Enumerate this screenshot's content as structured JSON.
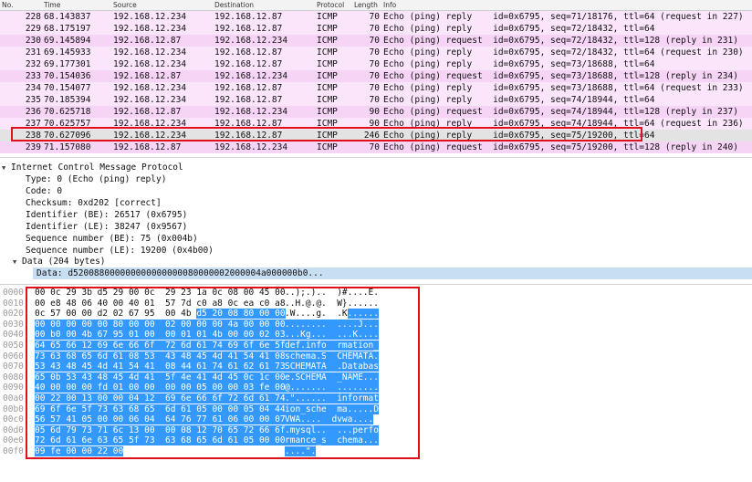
{
  "packet_list": {
    "columns": {
      "no": "No.",
      "time": "Time",
      "source": "Source",
      "destination": "Destination",
      "protocol": "Protocol",
      "length": "Length",
      "info": "Info"
    },
    "rows": [
      {
        "no": "228",
        "time": "68.143837",
        "src": "192.168.12.234",
        "dst": "192.168.12.87",
        "proto": "ICMP",
        "len": "70",
        "info": "Echo (ping) reply    id=0x6795, seq=71/18176, ttl=64 (request in 227)",
        "kind": "reply"
      },
      {
        "no": "229",
        "time": "68.175197",
        "src": "192.168.12.234",
        "dst": "192.168.12.87",
        "proto": "ICMP",
        "len": "70",
        "info": "Echo (ping) reply    id=0x6795, seq=72/18432, ttl=64",
        "kind": "reply"
      },
      {
        "no": "230",
        "time": "69.145894",
        "src": "192.168.12.87",
        "dst": "192.168.12.234",
        "proto": "ICMP",
        "len": "70",
        "info": "Echo (ping) request  id=0x6795, seq=72/18432, ttl=128 (reply in 231)",
        "kind": "request"
      },
      {
        "no": "231",
        "time": "69.145933",
        "src": "192.168.12.234",
        "dst": "192.168.12.87",
        "proto": "ICMP",
        "len": "70",
        "info": "Echo (ping) reply    id=0x6795, seq=72/18432, ttl=64 (request in 230)",
        "kind": "reply"
      },
      {
        "no": "232",
        "time": "69.177301",
        "src": "192.168.12.234",
        "dst": "192.168.12.87",
        "proto": "ICMP",
        "len": "70",
        "info": "Echo (ping) reply    id=0x6795, seq=73/18688, ttl=64",
        "kind": "reply"
      },
      {
        "no": "233",
        "time": "70.154036",
        "src": "192.168.12.87",
        "dst": "192.168.12.234",
        "proto": "ICMP",
        "len": "70",
        "info": "Echo (ping) request  id=0x6795, seq=73/18688, ttl=128 (reply in 234)",
        "kind": "request"
      },
      {
        "no": "234",
        "time": "70.154077",
        "src": "192.168.12.234",
        "dst": "192.168.12.87",
        "proto": "ICMP",
        "len": "70",
        "info": "Echo (ping) reply    id=0x6795, seq=73/18688, ttl=64 (request in 233)",
        "kind": "reply"
      },
      {
        "no": "235",
        "time": "70.185394",
        "src": "192.168.12.234",
        "dst": "192.168.12.87",
        "proto": "ICMP",
        "len": "70",
        "info": "Echo (ping) reply    id=0x6795, seq=74/18944, ttl=64",
        "kind": "reply"
      },
      {
        "no": "236",
        "time": "70.625718",
        "src": "192.168.12.87",
        "dst": "192.168.12.234",
        "proto": "ICMP",
        "len": "90",
        "info": "Echo (ping) request  id=0x6795, seq=74/18944, ttl=128 (reply in 237)",
        "kind": "request"
      },
      {
        "no": "237",
        "time": "70.625757",
        "src": "192.168.12.234",
        "dst": "192.168.12.87",
        "proto": "ICMP",
        "len": "90",
        "info": "Echo (ping) reply    id=0x6795, seq=74/18944, ttl=64 (request in 236)",
        "kind": "reply"
      },
      {
        "no": "238",
        "time": "70.627096",
        "src": "192.168.12.234",
        "dst": "192.168.12.87",
        "proto": "ICMP",
        "len": "246",
        "info": "Echo (ping) reply    id=0x6795, seq=75/19200, ttl=64",
        "kind": "selected"
      },
      {
        "no": "239",
        "time": "71.157080",
        "src": "192.168.12.87",
        "dst": "192.168.12.234",
        "proto": "ICMP",
        "len": "70",
        "info": "Echo (ping) request  id=0x6795, seq=75/19200, ttl=128 (reply in 240)",
        "kind": "request"
      }
    ]
  },
  "details": {
    "section_title": "Internet Control Message Protocol",
    "fields": [
      "Type: 0 (Echo (ping) reply)",
      "Code: 0",
      "Checksum: 0xd202 [correct]",
      "Identifier (BE): 26517 (0x6795)",
      "Identifier (LE): 38247 (0x9567)",
      "Sequence number (BE): 75 (0x004b)",
      "Sequence number (LE): 19200 (0x4b00)"
    ],
    "data_title": "Data (204 bytes)",
    "data_value": "Data: d520088000000000000000080000002000004a000000b0..."
  },
  "hex_dump": [
    {
      "offset": "0000",
      "pre": "00 0c 29 3b d5 29 00 0c  29 23 1a 0c 08 00 45 00",
      "sel": "",
      "apre": "..);.)..  )#....E.",
      "asel": ""
    },
    {
      "offset": "0010",
      "pre": "00 e8 48 06 40 00 40 01  57 7d c0 a8 0c ea c0 a8",
      "sel": "",
      "apre": "..H.@.@.  W}......",
      "asel": ""
    },
    {
      "offset": "0020",
      "pre": "0c 57 00 00 d2 02 67 95  00 4b ",
      "sel": "d5 20 08 80 00 00",
      "apre": ".W....g.  .K",
      "asel": "......"
    },
    {
      "offset": "0030",
      "pre": "",
      "sel": "00 00 00 00 00 80 00 00  02 00 00 00 4a 00 00 00",
      "apre": "",
      "asel": "........  ....J..."
    },
    {
      "offset": "0040",
      "pre": "",
      "sel": "00 b0 00 4b 67 95 01 00  00 01 01 4b 00 00 02 03",
      "apre": "",
      "asel": "...Kg...  ...K...."
    },
    {
      "offset": "0050",
      "pre": "",
      "sel": "64 65 66 12 69 6e 66 6f  72 6d 61 74 69 6f 6e 5f",
      "apre": "",
      "asel": "def.info  rmation_"
    },
    {
      "offset": "0060",
      "pre": "",
      "sel": "73 63 68 65 6d 61 08 53  43 48 45 4d 41 54 41 08",
      "apre": "",
      "asel": "schema.S  CHEMATA."
    },
    {
      "offset": "0070",
      "pre": "",
      "sel": "53 43 48 45 4d 41 54 41  08 44 61 74 61 62 61 73",
      "apre": "",
      "asel": "SCHEMATA  .Databas"
    },
    {
      "offset": "0080",
      "pre": "",
      "sel": "65 0b 53 43 48 45 4d 41  5f 4e 41 4d 45 0c 1c 00",
      "apre": "",
      "asel": "e.SCHEMA  _NAME..."
    },
    {
      "offset": "0090",
      "pre": "",
      "sel": "40 00 00 00 fd 01 00 00  00 00 05 00 00 03 fe 00",
      "apre": "",
      "asel": "@.......  ........"
    },
    {
      "offset": "00a0",
      "pre": "",
      "sel": "00 22 00 13 00 00 04 12  69 6e 66 6f 72 6d 61 74",
      "apre": "",
      "asel": ".\"......  informat"
    },
    {
      "offset": "00b0",
      "pre": "",
      "sel": "69 6f 6e 5f 73 63 68 65  6d 61 05 00 00 05 04 44",
      "apre": "",
      "asel": "ion_sche  ma.....D"
    },
    {
      "offset": "00c0",
      "pre": "",
      "sel": "56 57 41 05 00 00 06 04  64 76 77 61 06 00 00 07",
      "apre": "",
      "asel": "VWA....  dvwa...."
    },
    {
      "offset": "00d0",
      "pre": "",
      "sel": "05 6d 79 73 71 6c 13 00  00 08 12 70 65 72 66 6f",
      "apre": "",
      "asel": ".mysql..  ...perfo"
    },
    {
      "offset": "00e0",
      "pre": "",
      "sel": "72 6d 61 6e 63 65 5f 73  63 68 65 6d 61 05 00 00",
      "apre": "",
      "asel": "rmance_s  chema..."
    },
    {
      "offset": "00f0",
      "pre": "",
      "sel": "09 fe 00 00 22 00",
      "apre": "",
      "asel": "....\"."
    }
  ]
}
